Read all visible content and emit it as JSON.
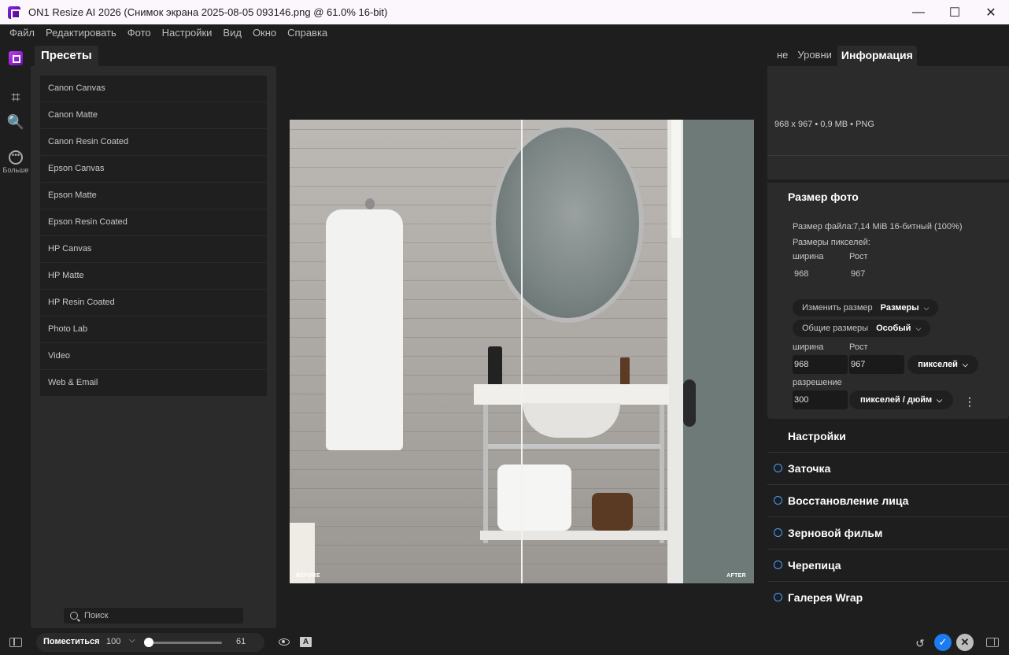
{
  "window": {
    "title": "ON1 Resize AI 2026 (Снимок экрана 2025-08-05 093146.png @ 61.0% 16-bit)",
    "controls": [
      "—",
      "☐",
      "✕"
    ]
  },
  "menu": [
    "Файл",
    "Редактировать",
    "Фото",
    "Настройки",
    "Вид",
    "Окно",
    "Справка"
  ],
  "toolbar": {
    "more_label": "Больше"
  },
  "presets": {
    "tab_label": "Пресеты",
    "items": [
      "Canon Canvas",
      "Canon Matte",
      "Canon Resin Coated",
      "Epson Canvas",
      "Epson Matte",
      "Epson Resin Coated",
      "HP Canvas",
      "HP Matte",
      "HP Resin Coated",
      "Photo Lab",
      "Video",
      "Web & Email"
    ],
    "search_placeholder": "Поиск"
  },
  "preview": {
    "before_label": "BEFORE",
    "after_label": "AFTER"
  },
  "right_panel": {
    "tabs": [
      "не",
      "Уровни",
      "Информация"
    ],
    "active_tab": "Информация",
    "info_summary": "968 x 967 • 0,9 MB • PNG",
    "photo_size": {
      "heading": "Размер фото",
      "file_size_label": "Размер файла:",
      "file_size_value": "7,14 MiB 16-битный (100%)",
      "pixel_dims_label": "Размеры пикселей:",
      "width_label": "ширина",
      "height_label": "Рост",
      "width_value": "968",
      "height_value": "967",
      "resize_label": "Изменить размер",
      "resize_value": "Размеры",
      "common_sizes_label": "Общие размеры",
      "common_sizes_value": "Особый",
      "edit_width_label": "ширина",
      "edit_height_label": "Рост",
      "edit_width_value": "968",
      "edit_height_value": "967",
      "units_value": "пикселей",
      "resolution_label": "разрешение",
      "resolution_value": "300",
      "resolution_units": "пикселей / дюйм"
    },
    "settings_heading": "Настройки",
    "settings_items": [
      "Заточка",
      "Восстановление лица",
      "Зерновой фильм",
      "Черепица",
      "Галерея Wrap"
    ]
  },
  "bottom_bar": {
    "fit_label": "Поместиться",
    "zoom_value": "100",
    "slider_value": "61",
    "slider_fraction": 0.0
  }
}
